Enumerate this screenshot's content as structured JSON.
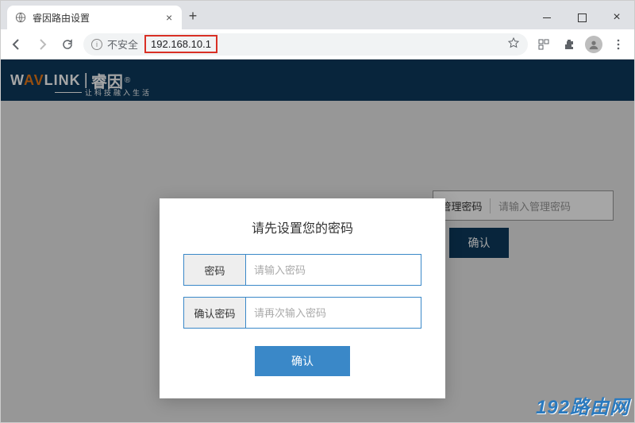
{
  "browser": {
    "tab_title": "睿因路由设置",
    "insecure_label": "不安全",
    "url": "192.168.10.1"
  },
  "header": {
    "logo_left": "W",
    "logo_av": "AV",
    "logo_right": "LINK",
    "logo_cn": "睿因",
    "reg": "®",
    "tagline": "让科技融入生活"
  },
  "background_form": {
    "admin_label": "管理密码",
    "admin_placeholder": "请输入管理密码",
    "confirm_label": "确认"
  },
  "modal": {
    "title": "请先设置您的密码",
    "password_label": "密码",
    "password_placeholder": "请输入密码",
    "confirm_password_label": "确认密码",
    "confirm_password_placeholder": "请再次输入密码",
    "confirm_button": "确认"
  },
  "watermark": "192路由网"
}
